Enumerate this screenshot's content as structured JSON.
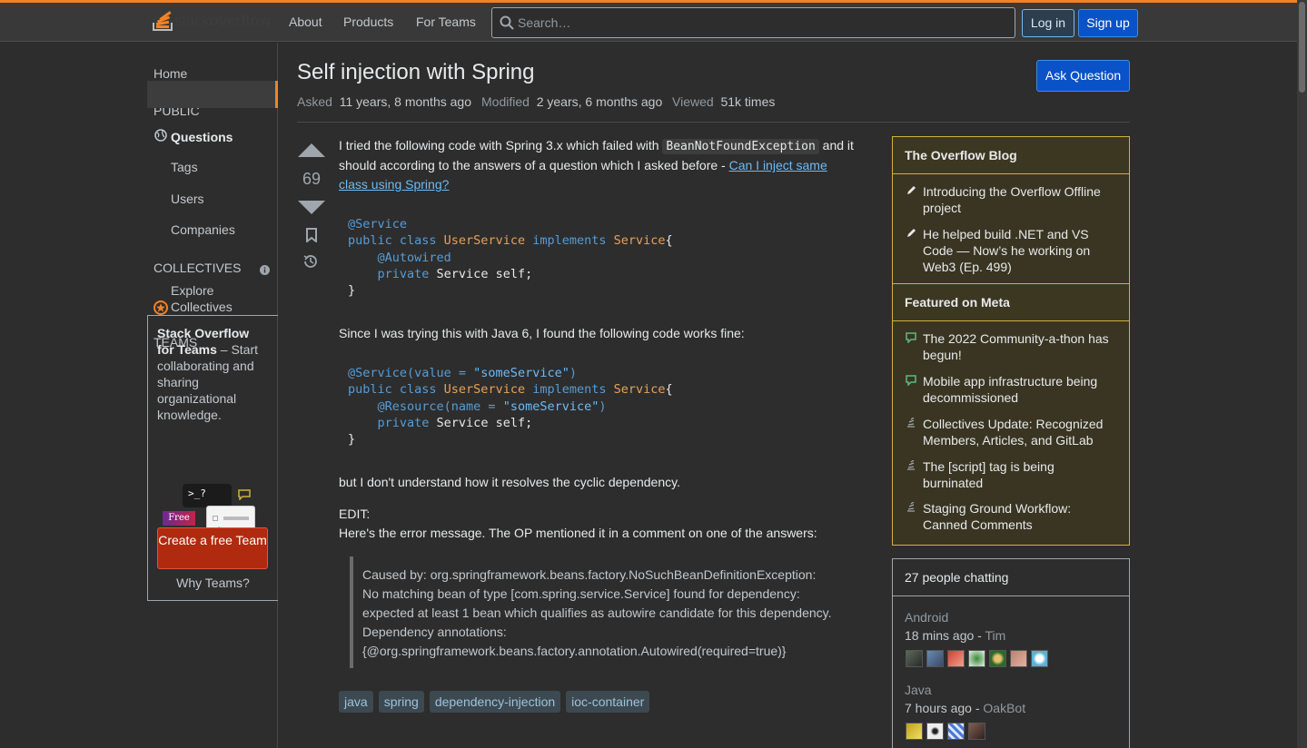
{
  "header": {
    "logo_text_plain": "stack",
    "logo_text_bold": "overflow",
    "nav": [
      "About",
      "Products",
      "For Teams"
    ],
    "search_placeholder": "Search…",
    "login_label": "Log in",
    "signup_label": "Sign up",
    "accent": "#f48225"
  },
  "sidebar": {
    "home": "Home",
    "public_heading": "PUBLIC",
    "questions": "Questions",
    "tags": "Tags",
    "users": "Users",
    "companies": "Companies",
    "collectives_heading": "COLLECTIVES",
    "explore": "Explore",
    "collectives": "Collectives",
    "teams_heading": "TEAMS",
    "teams_title": "Stack Overflow for Teams",
    "teams_desc": " – Start collaborating and sharing organizational knowledge.",
    "free_badge": "Free",
    "terminal_prompt": ">_?",
    "create_team": "Create a free Team",
    "why_teams": "Why Teams?"
  },
  "question": {
    "title": "Self injection with Spring",
    "asked_label": "Asked",
    "asked_value": "11 years, 8 months ago",
    "modified_label": "Modified",
    "modified_value": "2 years, 6 months ago",
    "viewed_label": "Viewed",
    "viewed_value": "51k times",
    "ask_button": "Ask Question",
    "votes": "69",
    "p1_a": "I tried the following code with Spring 3.x which failed with ",
    "p1_code": "BeanNotFoundException",
    "p1_b": " and it should according to the answers of a question which I asked before - ",
    "p1_link": "Can I inject same class using Spring?",
    "p2": "Since I was trying this with Java 6, I found the following code works fine:",
    "p3": "but I don't understand how it resolves the cyclic dependency.",
    "p4": "EDIT:",
    "p5": "Here's the error message. The OP mentioned it in a comment on one of the answers:",
    "quote": "Caused by: org.springframework.beans.factory.NoSuchBeanDefinitionException: No matching bean of type [com.spring.service.Service] found for dependency: expected at least 1 bean which qualifies as autowire candidate for this dependency. Dependency annotations: {@org.springframework.beans.factory.annotation.Autowired(required=true)}",
    "tags": [
      "java",
      "spring",
      "dependency-injection",
      "ioc-container"
    ]
  },
  "code1": {
    "l1_an": "@Service",
    "l2_kw1": "public class ",
    "l2_ty1": "UserService",
    "l2_kw2": " implements ",
    "l2_ty2": "Service",
    "l2_pl": "{",
    "l3_an": "@Autowired",
    "l4_kw": "private ",
    "l4_pl": "Service self;",
    "l5_pl": "}"
  },
  "code2": {
    "l1_an": "@Service(value = ",
    "l1_st": "\"someService\"",
    "l1_an2": ")",
    "l2_kw1": "public class ",
    "l2_ty1": "UserService",
    "l2_kw2": " implements ",
    "l2_ty2": "Service",
    "l2_pl": "{",
    "l3_an": "@Resource(name = ",
    "l3_st": "\"someService\"",
    "l3_an2": ")",
    "l4_kw": "private ",
    "l4_pl": "Service self;",
    "l5_pl": "}"
  },
  "blog": {
    "heading": "The Overflow Blog",
    "items": [
      "Introducing the Overflow Offline project",
      "He helped build .NET and VS Code — Now’s he working on Web3 (Ep. 499)"
    ]
  },
  "meta_widget": {
    "heading": "Featured on Meta",
    "items": [
      "The 2022 Community-a-thon has begun!",
      "Mobile app infrastructure being decommissioned",
      "Collectives Update: Recognized Members, Articles, and GitLab",
      "The [script] tag is being burninated",
      "Staging Ground Workflow: Canned Comments"
    ]
  },
  "chat": {
    "heading": "27 people chatting",
    "rooms": [
      {
        "name": "Android",
        "time": "18 mins ago",
        "sep": " - ",
        "user": "Tim"
      },
      {
        "name": "Java",
        "time": "7 hours ago",
        "sep": " - ",
        "user": "OakBot"
      }
    ]
  }
}
